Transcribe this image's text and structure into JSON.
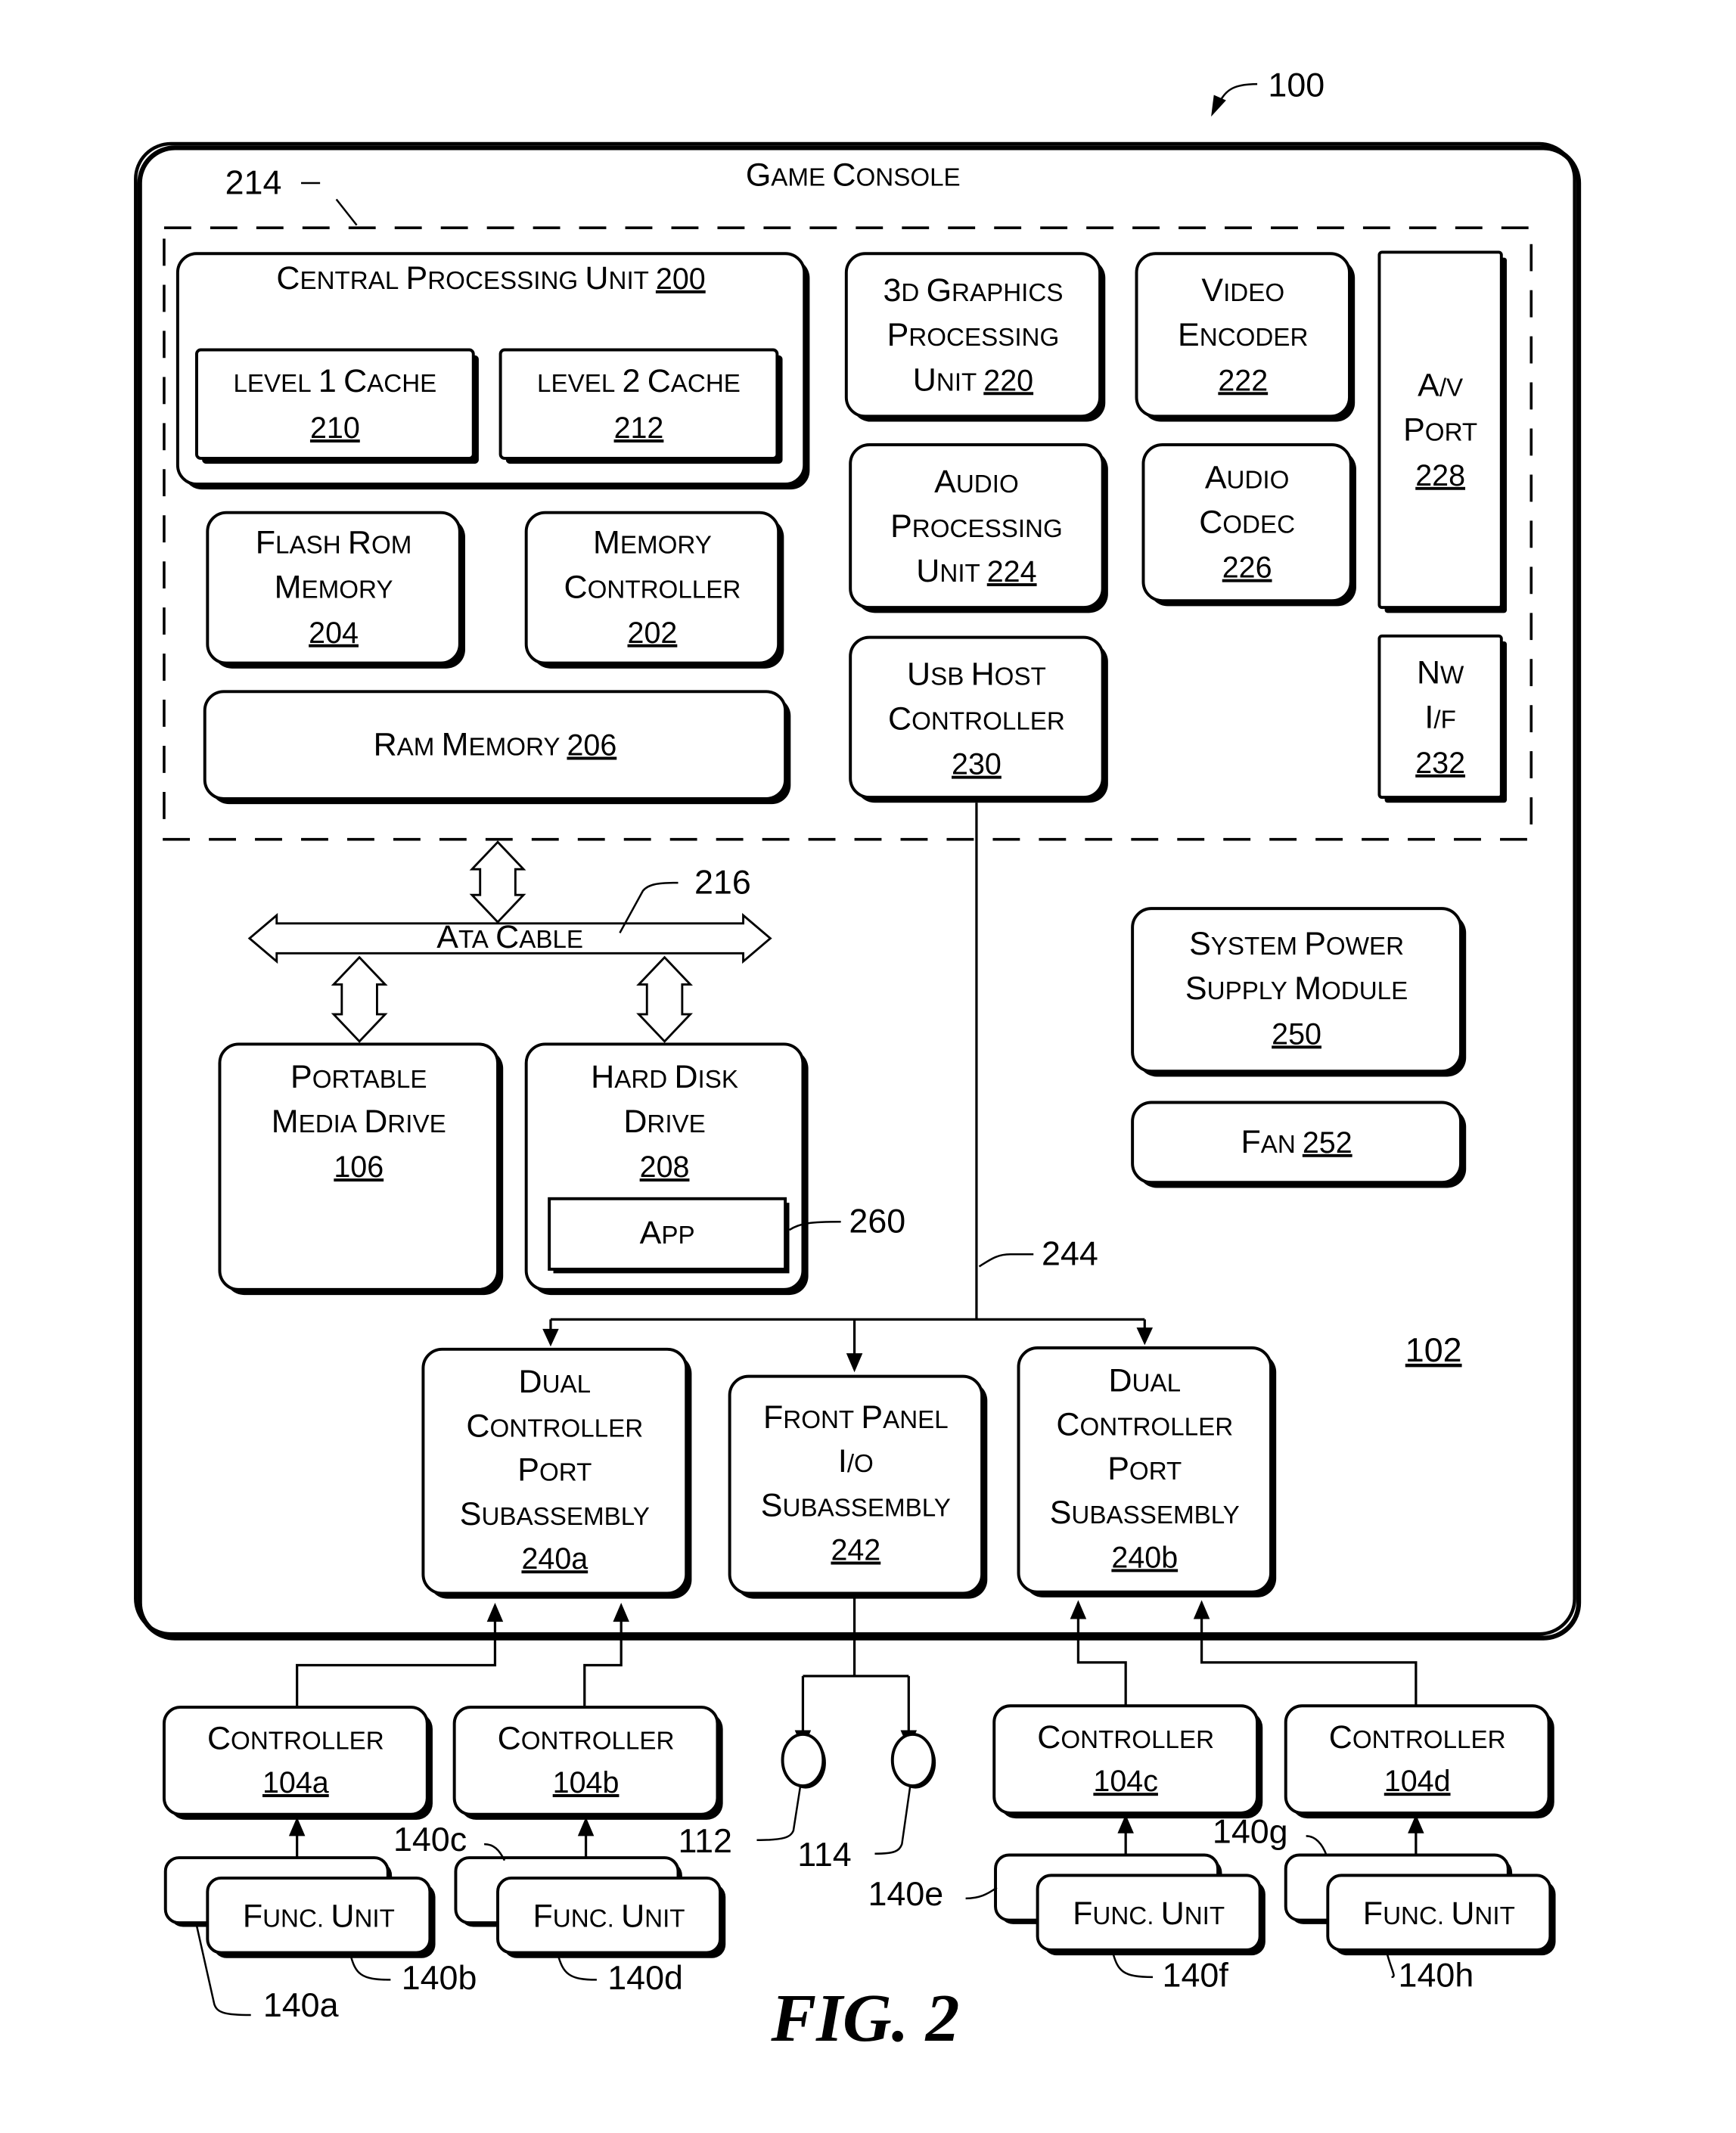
{
  "figure": {
    "label": "FIG. 2",
    "ref_system": "100",
    "console_title": "Game Console",
    "console_ref": "102",
    "chipset_ref": "214",
    "ata_ref": "216",
    "usb_bus_ref": "244",
    "app_ref": "260"
  },
  "blocks": {
    "cpu": {
      "lines": [
        "Central Processing Unit"
      ],
      "ref": "200"
    },
    "l1": {
      "lines": [
        "level 1 Cache"
      ],
      "ref": "210"
    },
    "l2": {
      "lines": [
        "level 2 Cache"
      ],
      "ref": "212"
    },
    "flash": {
      "lines": [
        "Flash ROM",
        "Memory"
      ],
      "ref": "204"
    },
    "memctl": {
      "lines": [
        "Memory",
        "Controller"
      ],
      "ref": "202"
    },
    "ram": {
      "lines": [
        "RAM Memory"
      ],
      "ref": "206"
    },
    "gpu": {
      "lines": [
        "3D Graphics",
        "Processing",
        "Unit"
      ],
      "ref": "220"
    },
    "venc": {
      "lines": [
        "Video",
        "Encoder"
      ],
      "ref": "222"
    },
    "apu": {
      "lines": [
        "Audio",
        "Processing",
        "Unit"
      ],
      "ref": "224"
    },
    "acodec": {
      "lines": [
        "Audio",
        "Codec"
      ],
      "ref": "226"
    },
    "avport": {
      "lines": [
        "A/V",
        "Port"
      ],
      "ref": "228"
    },
    "usb": {
      "lines": [
        "USB Host",
        "Controller"
      ],
      "ref": "230"
    },
    "nwif": {
      "lines": [
        "NW",
        "I/F"
      ],
      "ref": "232"
    },
    "ata": {
      "label": "ATA Cable"
    },
    "pmd": {
      "lines": [
        "Portable",
        "Media Drive"
      ],
      "ref": "106"
    },
    "hdd": {
      "lines": [
        "Hard Disk",
        "Drive"
      ],
      "ref": "208"
    },
    "app": {
      "label": "App"
    },
    "psu": {
      "lines": [
        "System Power",
        "Supply Module"
      ],
      "ref": "250"
    },
    "fan": {
      "lines": [
        "Fan"
      ],
      "ref": "252"
    },
    "dcp_a": {
      "lines": [
        "Dual",
        "Controller",
        "Port",
        "Subassembly"
      ],
      "ref": "240a"
    },
    "fpio": {
      "lines": [
        "Front Panel",
        "I/O",
        "Subassembly"
      ],
      "ref": "242"
    },
    "dcp_b": {
      "lines": [
        "Dual",
        "Controller",
        "Port",
        "Subassembly"
      ],
      "ref": "240b"
    }
  },
  "controllers": [
    {
      "label": "Controller",
      "ref": "104a"
    },
    {
      "label": "Controller",
      "ref": "104b"
    },
    {
      "label": "Controller",
      "ref": "104c"
    },
    {
      "label": "Controller",
      "ref": "104d"
    }
  ],
  "func_units": {
    "label": "Func. Unit",
    "refs": [
      "140a",
      "140b",
      "140c",
      "140d",
      "140e",
      "140f",
      "140g",
      "140h"
    ]
  },
  "front_panel_items": [
    "112",
    "114"
  ]
}
